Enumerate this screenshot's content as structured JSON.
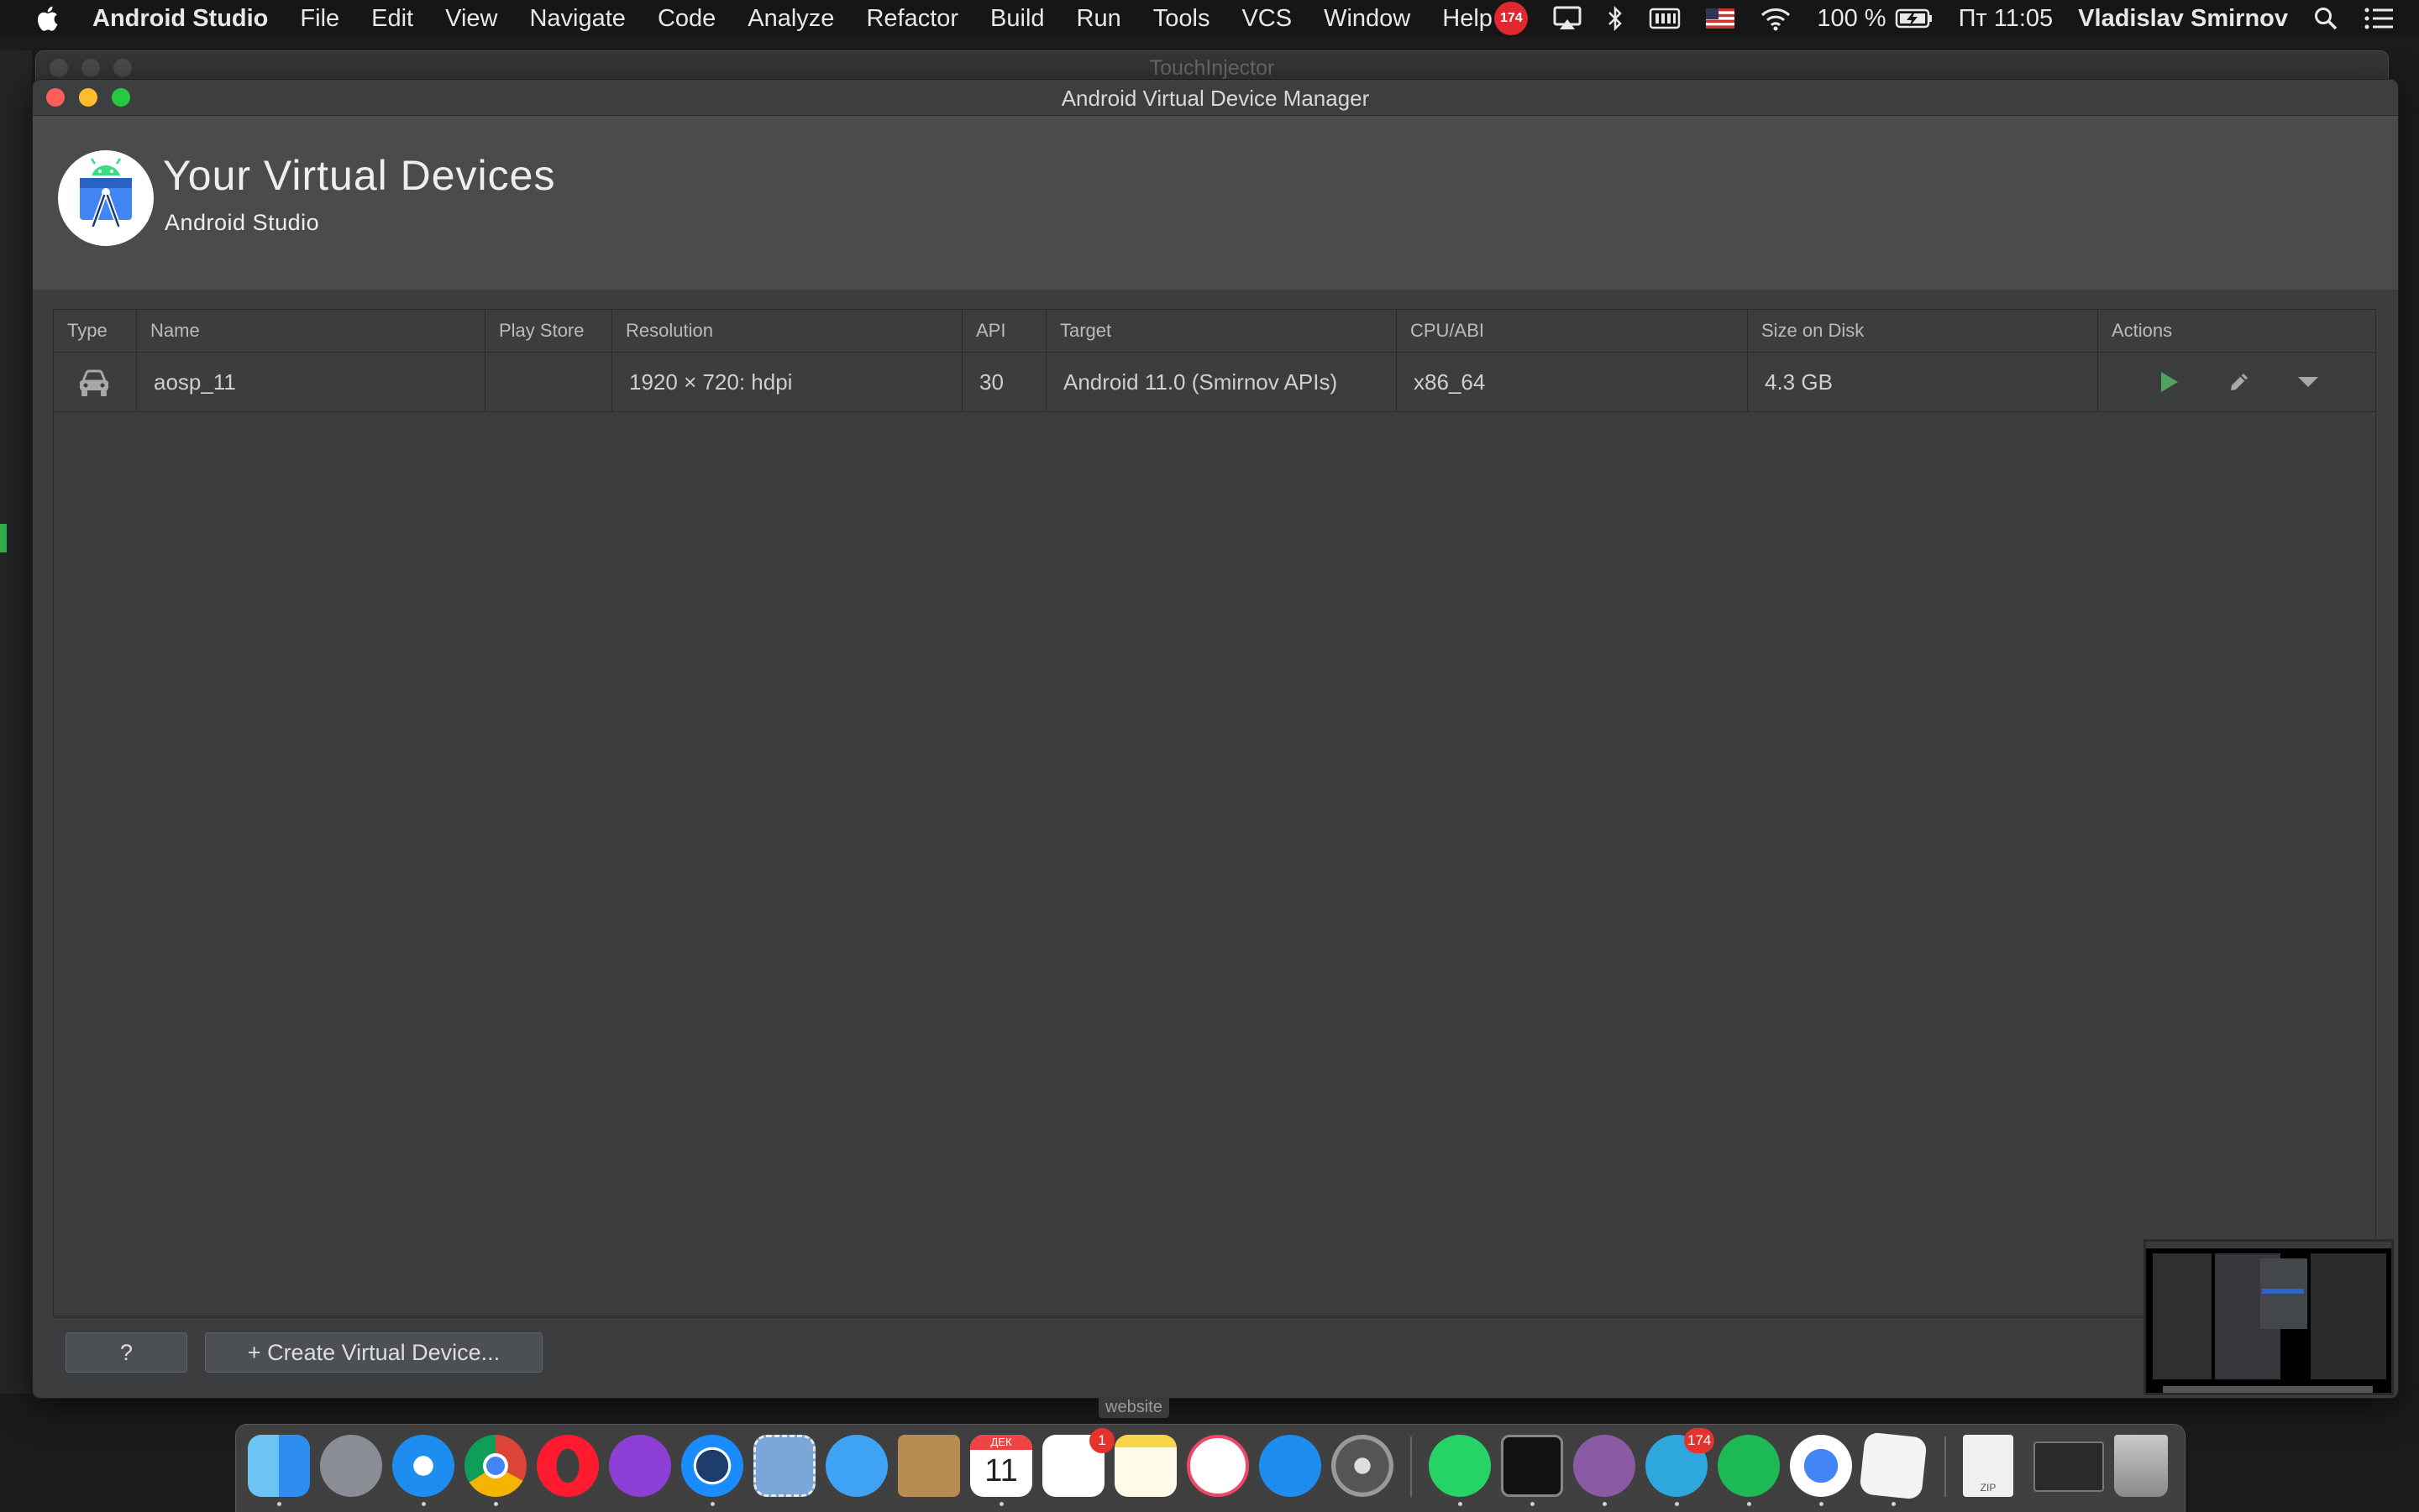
{
  "menubar": {
    "app_name": "Android Studio",
    "menus": [
      "File",
      "Edit",
      "View",
      "Navigate",
      "Code",
      "Analyze",
      "Refactor",
      "Build",
      "Run",
      "Tools",
      "VCS",
      "Window",
      "Help"
    ],
    "notification_count": "174",
    "battery": "100 %",
    "clock": "Пт 11:05",
    "user": "Vladislav Smirnov"
  },
  "background_window": {
    "title": "TouchInjector"
  },
  "dialog": {
    "title": "Android Virtual Device Manager",
    "header_title": "Your Virtual Devices",
    "header_subtitle": "Android Studio"
  },
  "table": {
    "columns": [
      "Type",
      "Name",
      "Play Store",
      "Resolution",
      "API",
      "Target",
      "CPU/ABI",
      "Size on Disk",
      "Actions"
    ],
    "rows": [
      {
        "type_icon": "car-icon",
        "name": "aosp_11",
        "play_store": "",
        "resolution": "1920 × 720: hdpi",
        "api": "30",
        "target": "Android 11.0 (Smirnov APIs)",
        "cpu_abi": "x86_64",
        "size_on_disk": "4.3 GB"
      }
    ]
  },
  "footer": {
    "help_label": "?",
    "create_label": "+ Create Virtual Device..."
  },
  "dock": {
    "tooltip": "website",
    "calendar_month": "ДЕК",
    "calendar_day": "11",
    "reminders_badge": "1",
    "telegram_badge": "174",
    "zip_label": "ZIP"
  },
  "colors": {
    "run_green": "#4ea45a",
    "dialog_bg": "#3b3d3f",
    "header_bg": "#4a4b4d",
    "traffic_red": "#fe5f57",
    "traffic_yellow": "#febc2e",
    "traffic_green": "#28c840"
  }
}
